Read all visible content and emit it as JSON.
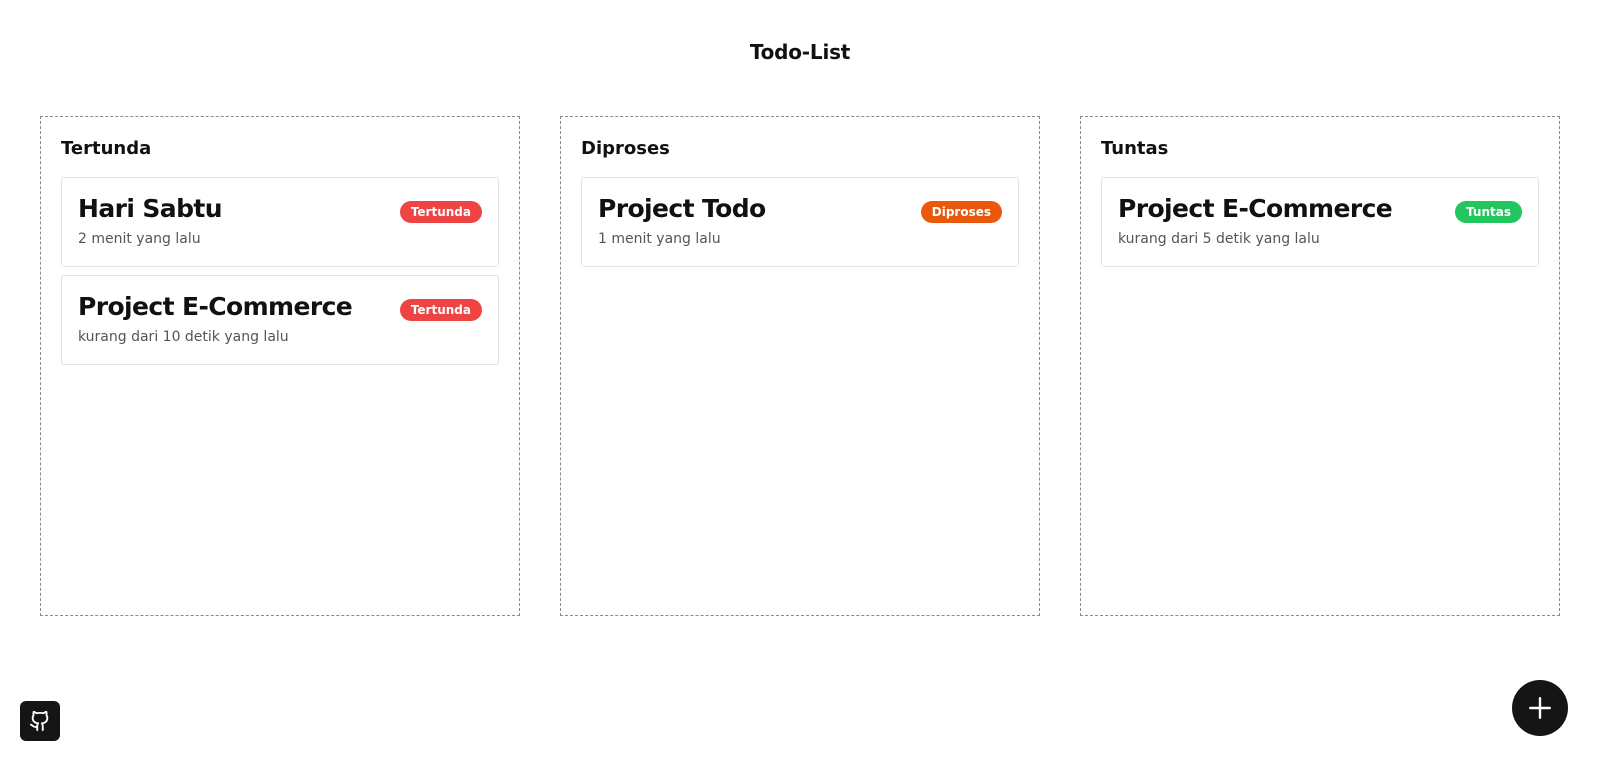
{
  "page": {
    "title": "Todo-List"
  },
  "columns": [
    {
      "title": "Tertunda",
      "cards": [
        {
          "title": "Hari Sabtu",
          "status": "Tertunda",
          "time": "2 menit yang lalu"
        },
        {
          "title": "Project E-Commerce",
          "status": "Tertunda",
          "time": "kurang dari 10 detik yang lalu"
        }
      ]
    },
    {
      "title": "Diproses",
      "cards": [
        {
          "title": "Project Todo",
          "status": "Diproses",
          "time": "1 menit yang lalu"
        }
      ]
    },
    {
      "title": "Tuntas",
      "cards": [
        {
          "title": "Project E-Commerce",
          "status": "Tuntas",
          "time": "kurang dari 5 detik yang lalu"
        }
      ]
    }
  ],
  "status_colors": {
    "Tertunda": "#ef4444",
    "Diproses": "#ea580c",
    "Tuntas": "#22c55e"
  },
  "icons": {
    "add": "plus-icon",
    "repo": "github-icon"
  }
}
